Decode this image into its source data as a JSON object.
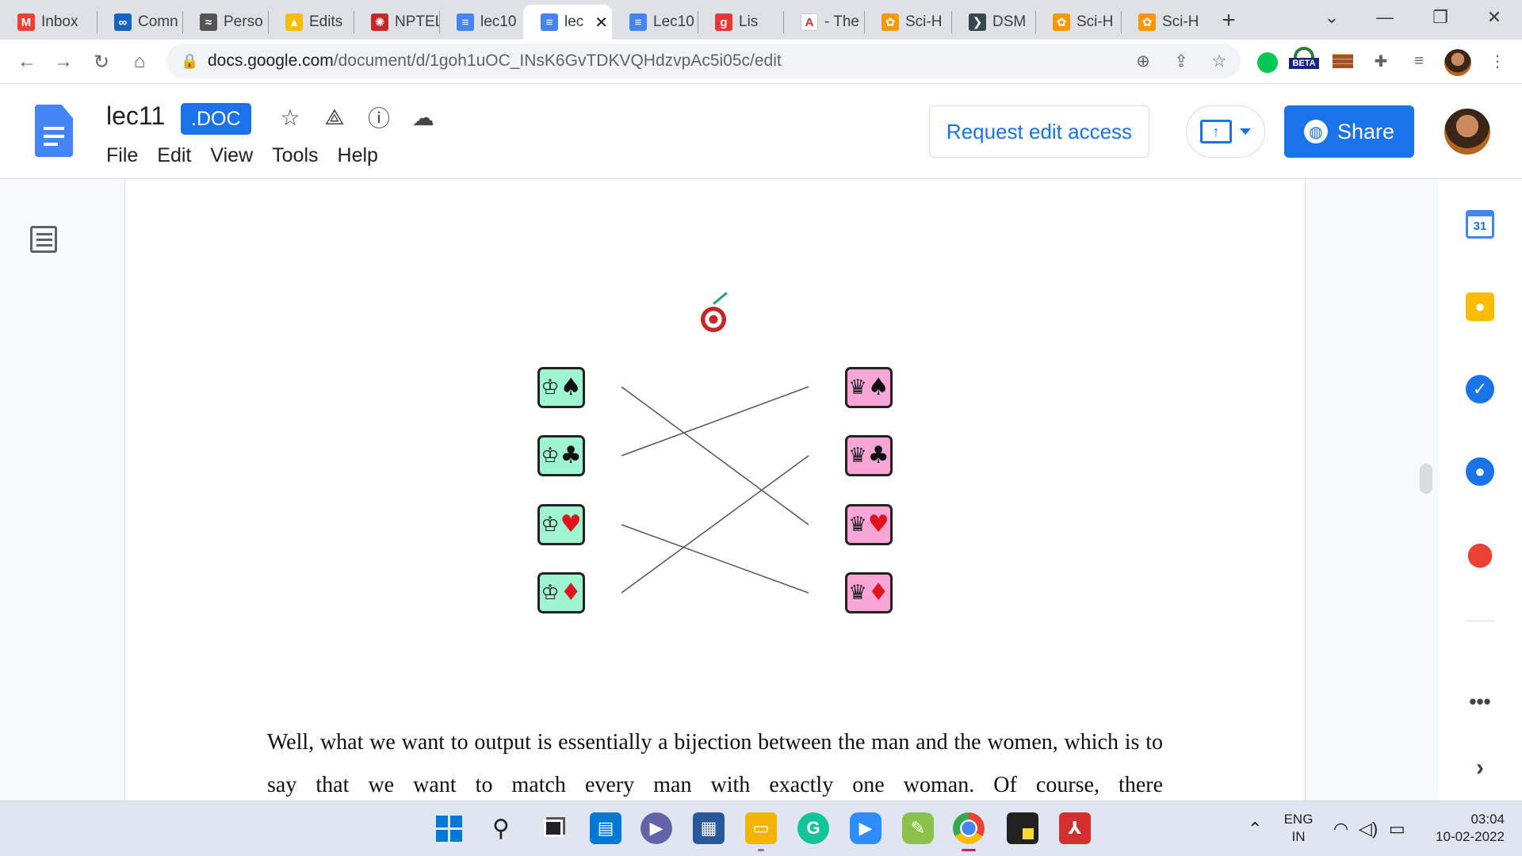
{
  "browser": {
    "tabs": [
      {
        "title": "Inbox",
        "icon": "gmail-icon",
        "color": "#ea4335",
        "glyph": "M"
      },
      {
        "title": "Comn",
        "icon": "link-icon",
        "color": "#1565c0",
        "glyph": "∞"
      },
      {
        "title": "Perso",
        "icon": "dna-icon",
        "color": "#555555",
        "glyph": "≈"
      },
      {
        "title": "Edits",
        "icon": "drive-icon",
        "color": "#fbbc04",
        "glyph": "▲"
      },
      {
        "title": "NPTEL",
        "icon": "nptel-icon",
        "color": "#c62828",
        "glyph": "✺"
      },
      {
        "title": "lec10",
        "icon": "docs-icon",
        "color": "#4285f4",
        "glyph": "≡"
      },
      {
        "title": "lec",
        "icon": "docs-icon",
        "color": "#4285f4",
        "glyph": "≡"
      },
      {
        "title": "Lec10",
        "icon": "docs-icon",
        "color": "#4285f4",
        "glyph": "≡"
      },
      {
        "title": "Lis",
        "icon": "audio-icon",
        "color": "#e53935",
        "glyph": "g"
      },
      {
        "title": "- The",
        "icon": "letter-a-icon",
        "color": "#ffffff",
        "glyph": "A"
      },
      {
        "title": "Sci-H",
        "icon": "scihub-icon",
        "color": "#ff9800",
        "glyph": "✿"
      },
      {
        "title": "DSM",
        "icon": "dsm-icon",
        "color": "#37474f",
        "glyph": "❯"
      },
      {
        "title": "Sci-H",
        "icon": "scihub-icon",
        "color": "#ff9800",
        "glyph": "✿"
      },
      {
        "title": "Sci-H",
        "icon": "scihub-icon",
        "color": "#ff9800",
        "glyph": "✿"
      }
    ],
    "active_tab_index": 6,
    "url_host": "docs.google.com",
    "url_path": "/document/d/1goh1uOC_INsK6GvTDKVQHdzvpAc5i05c/edit",
    "beta_label": "BETA"
  },
  "docs": {
    "title": "lec11",
    "badge": ".DOC",
    "menu": [
      "File",
      "Edit",
      "View",
      "Tools",
      "Help"
    ],
    "request_edit_label": "Request edit access",
    "share_label": "Share",
    "accent_color": "#1a73e8"
  },
  "document": {
    "figure": {
      "kings": [
        {
          "suit": "♠",
          "suit_color": "black"
        },
        {
          "suit": "♣",
          "suit_color": "black"
        },
        {
          "suit": "♥",
          "suit_color": "red"
        },
        {
          "suit": "♦",
          "suit_color": "red"
        }
      ],
      "queens": [
        {
          "suit": "♠",
          "suit_color": "black"
        },
        {
          "suit": "♣",
          "suit_color": "black"
        },
        {
          "suit": "♥",
          "suit_color": "red"
        },
        {
          "suit": "♦",
          "suit_color": "red"
        }
      ],
      "king_symbol": "♔",
      "queen_symbol": "♛",
      "matching": [
        [
          1,
          3
        ],
        [
          2,
          1
        ],
        [
          4,
          2
        ],
        [
          3,
          4
        ]
      ]
    },
    "paragraph": "Well, what we want to output is essentially a bijection between the man and the women, which is to say that we want to match every man with exactly one woman. Of course, there"
  },
  "side_panel": {
    "calendar_day": "31"
  },
  "taskbar": {
    "language_line1": "ENG",
    "language_line2": "IN",
    "time": "03:04",
    "date": "10-02-2022"
  }
}
